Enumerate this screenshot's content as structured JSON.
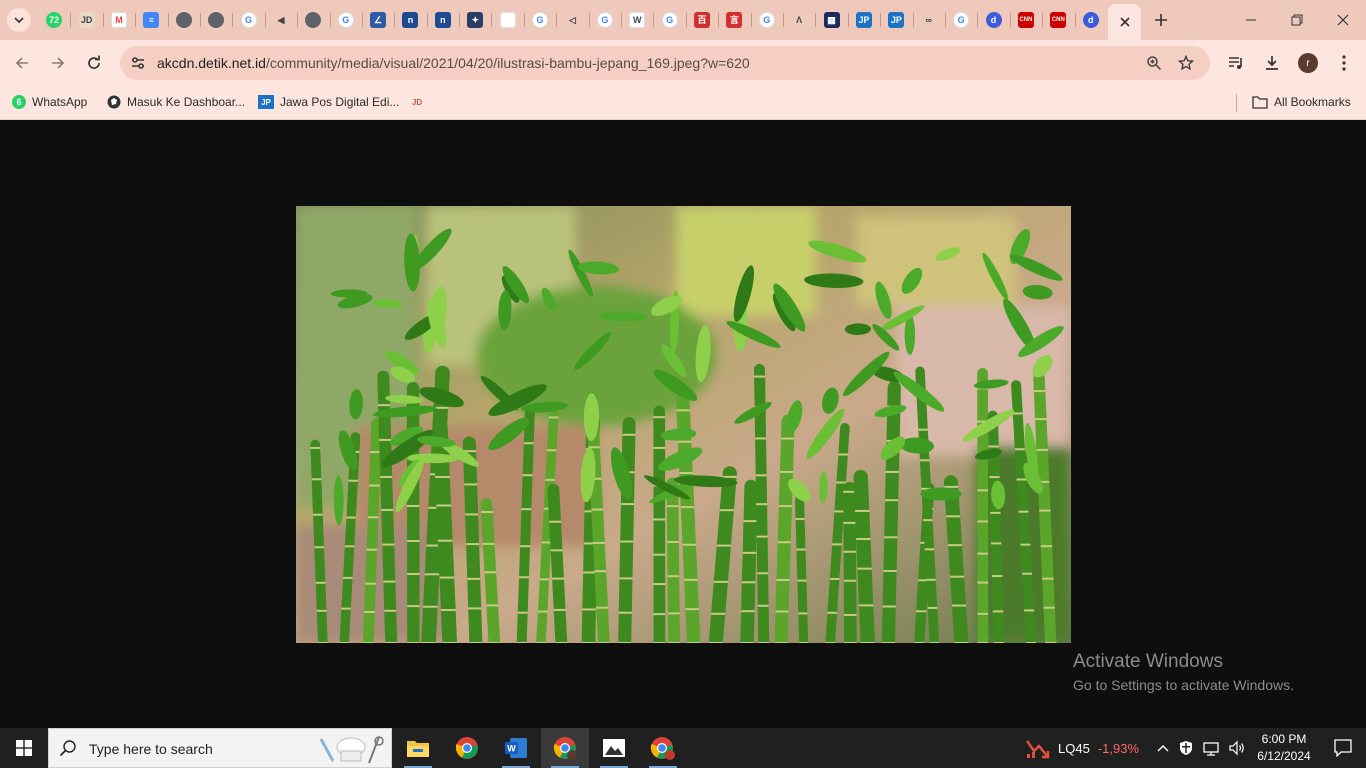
{
  "browser": {
    "tab_icons": [
      {
        "name": "tab-whatsapp-icon",
        "bg": "#25d366",
        "text": "72",
        "round": true
      },
      {
        "name": "tab-jdih-icon",
        "bg": "#e9d8c8",
        "text": "JD",
        "round": false
      },
      {
        "name": "tab-gmail-icon",
        "bg": "#ffffff",
        "text": "M",
        "round": false
      },
      {
        "name": "tab-docs-icon",
        "bg": "#4285f4",
        "text": "≡",
        "round": false
      },
      {
        "name": "tab-globe-icon",
        "bg": "#5f6368",
        "text": "",
        "round": true
      },
      {
        "name": "tab-globe-icon",
        "bg": "#5f6368",
        "text": "",
        "round": true
      },
      {
        "name": "tab-google-icon",
        "bg": "#ffffff",
        "text": "G",
        "round": true
      },
      {
        "name": "tab-speaker-icon",
        "bg": "#f0c9bd",
        "text": "◀",
        "round": false
      },
      {
        "name": "tab-chrome-icon",
        "bg": "#5f6368",
        "text": "",
        "round": true
      },
      {
        "name": "tab-google-icon",
        "bg": "#ffffff",
        "text": "G",
        "round": true
      },
      {
        "name": "tab-analytics-icon",
        "bg": "#2e5aa8",
        "text": "∠",
        "round": false
      },
      {
        "name": "tab-moodle-icon",
        "bg": "#1e4b8f",
        "text": "n",
        "round": false
      },
      {
        "name": "tab-moodle-icon",
        "bg": "#1e4b8f",
        "text": "n",
        "round": false
      },
      {
        "name": "tab-emblem-icon",
        "bg": "#2b3d66",
        "text": "✦",
        "round": false
      },
      {
        "name": "tab-blank-icon",
        "bg": "#ffffff",
        "text": "",
        "round": false
      },
      {
        "name": "tab-google-icon",
        "bg": "#ffffff",
        "text": "G",
        "round": true
      },
      {
        "name": "tab-arrow-icon",
        "bg": "#f0c9bd",
        "text": "◁",
        "round": false
      },
      {
        "name": "tab-google-icon",
        "bg": "#ffffff",
        "text": "G",
        "round": true
      },
      {
        "name": "tab-wikipedia-icon",
        "bg": "#ffffff",
        "text": "W",
        "round": false
      },
      {
        "name": "tab-google-icon",
        "bg": "#ffffff",
        "text": "G",
        "round": true
      },
      {
        "name": "tab-red-icon",
        "bg": "#d32f2f",
        "text": "百",
        "round": false
      },
      {
        "name": "tab-red-icon",
        "bg": "#d32f2f",
        "text": "言",
        "round": false
      },
      {
        "name": "tab-google-icon",
        "bg": "#ffffff",
        "text": "G",
        "round": true
      },
      {
        "name": "tab-lambda-icon",
        "bg": "#f0c9bd",
        "text": "Λ",
        "round": false
      },
      {
        "name": "tab-grid-icon",
        "bg": "#1b2b5a",
        "text": "▦",
        "round": false
      },
      {
        "name": "tab-jawapos-icon",
        "bg": "#1a73c7",
        "text": "JP",
        "round": false
      },
      {
        "name": "tab-jawapos-icon",
        "bg": "#1a73c7",
        "text": "JP",
        "round": false
      },
      {
        "name": "tab-binoculars-icon",
        "bg": "#f0c9bd",
        "text": "∞",
        "round": false
      },
      {
        "name": "tab-google-icon",
        "bg": "#ffffff",
        "text": "G",
        "round": true
      },
      {
        "name": "tab-detik-icon",
        "bg": "#3b5bdb",
        "text": "d",
        "round": true
      },
      {
        "name": "tab-cnn-icon",
        "bg": "#cc0000",
        "text": "CNN",
        "round": false
      },
      {
        "name": "tab-cnn-icon",
        "bg": "#cc0000",
        "text": "CNN",
        "round": false
      },
      {
        "name": "tab-detik-icon",
        "bg": "#3b5bdb",
        "text": "d",
        "round": true
      }
    ],
    "url_host": "akcdn.detik.net.id",
    "url_path": "/community/media/visual/2021/04/20/ilustrasi-bambu-jepang_169.jpeg?w=620",
    "profile_initial": "r",
    "bookmarks": [
      {
        "label": "WhatsApp",
        "icon": "whatsapp-icon"
      },
      {
        "label": "Masuk Ke Dashboar...",
        "icon": "globe-icon"
      },
      {
        "label": "Jawa Pos Digital Edi...",
        "icon": "jawapos-icon"
      },
      {
        "label": "",
        "icon": "jdih-icon"
      }
    ],
    "bookmark_badge": "6",
    "all_bookmarks": "All Bookmarks"
  },
  "content": {
    "image_subject": "lucky bamboo stalks photo",
    "watermark_title": "Activate Windows",
    "watermark_sub": "Go to Settings to activate Windows."
  },
  "taskbar": {
    "search_placeholder": "Type here to search",
    "stock_symbol": "LQ45",
    "stock_change": "-1,93%",
    "time": "6:00 PM",
    "date": "6/12/2024",
    "chrome_badge": "H"
  },
  "colors": {
    "tab_strip": "#f0c9bd",
    "toolbar": "#fde6df",
    "omnibox": "#f5cfc3",
    "viewer_bg": "#0e0e0e",
    "taskbar": "#202020"
  }
}
